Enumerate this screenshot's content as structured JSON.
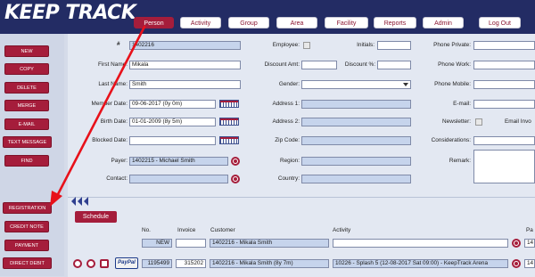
{
  "app": {
    "logo_text": "KEEP TRACK"
  },
  "tabs": [
    {
      "label": "Person",
      "active": true
    },
    {
      "label": "Activity"
    },
    {
      "label": "Group"
    },
    {
      "label": "Area"
    },
    {
      "label": "Facility"
    },
    {
      "label": "Reports"
    },
    {
      "label": "Admin"
    },
    {
      "label": "Log Out"
    }
  ],
  "sidebar_top": [
    "NEW",
    "COPY",
    "DELETE",
    "MERGE",
    "E-MAIL",
    "TEXT MESSAGE",
    "FIND"
  ],
  "sidebar_bottom": [
    "REGISTRATION",
    "CREDIT NOTE",
    "PAYMENT",
    "DIRECT DEBIT"
  ],
  "form": {
    "id_marker": "#",
    "id_value": "1402216",
    "first_name_label": "First Name:",
    "first_name_value": "Mikala",
    "last_name_label": "Last Name:",
    "last_name_value": "Smith",
    "member_date_label": "Member Date:",
    "member_date_value": "09-06-2017 (0y 0m)",
    "birth_date_label": "Birth Date:",
    "birth_date_value": "01-01-2009 (8y 5m)",
    "blocked_date_label": "Blocked Date:",
    "blocked_date_value": "",
    "payer_label": "Payer:",
    "payer_value": "1402215 - Michael Smith",
    "contact_label": "Contact:",
    "contact_value": "",
    "employee_label": "Employee:",
    "discount_amt_label": "Discount Amt:",
    "gender_label": "Gender:",
    "gender_value": "",
    "address1_label": "Address 1:",
    "address2_label": "Address 2:",
    "zip_label": "Zip Code:",
    "region_label": "Region:",
    "country_label": "Country:",
    "initials_label": "Initials:",
    "discount_pct_label": "Discount %:",
    "phone_private_label": "Phone Private:",
    "phone_work_label": "Phone Work:",
    "phone_mobile_label": "Phone Mobile:",
    "email_label": "E-mail:",
    "newsletter_label": "Newsletter:",
    "email_invoice_label": "Email Invo",
    "considerations_label": "Considerations:",
    "remark_label": "Remark:"
  },
  "lower": {
    "schedule_button": "Schedule",
    "columns": {
      "no": "No.",
      "invoice": "Invoice",
      "customer": "Customer",
      "activity": "Activity",
      "pa": "Pa"
    },
    "new_row": {
      "no": "NEW",
      "invoice": "",
      "customer": "1402216 - Mikala Smith",
      "activity": "",
      "pa": "14"
    },
    "row1": {
      "no": "1195499",
      "invoice": "315202",
      "customer": "1402216 - Mikala Smith (8y 7m)",
      "activity": "10226 - Splash 5 (12-08-2017 Sat 09:00) - KeepTrack Arena",
      "pa": "14",
      "paypal": "PayPal"
    }
  },
  "colors": {
    "brand_navy": "#232c64",
    "accent_red": "#a51d3b",
    "annotation_red": "#e8111a"
  }
}
